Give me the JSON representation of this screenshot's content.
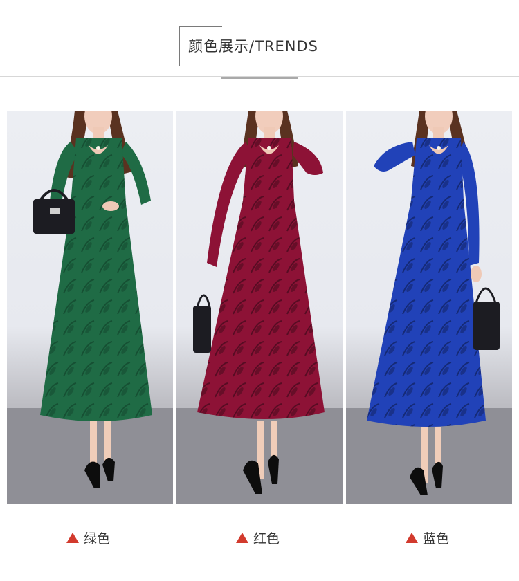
{
  "header": {
    "title": "颜色展示/TRENDS"
  },
  "colors": {
    "accent_triangle": "#d23a2d",
    "green_dress": "#1f6b45",
    "red_dress": "#8d1236",
    "blue_dress": "#2142b8"
  },
  "variants": [
    {
      "label": "绿色",
      "image": "green-dress-model-photo",
      "dress_color": "#1f6b45"
    },
    {
      "label": "红色",
      "image": "red-dress-model-photo",
      "dress_color": "#8d1236"
    },
    {
      "label": "蓝色",
      "image": "blue-dress-model-photo",
      "dress_color": "#2142b8"
    }
  ],
  "icons": {
    "label_marker": "triangle-up-icon"
  }
}
